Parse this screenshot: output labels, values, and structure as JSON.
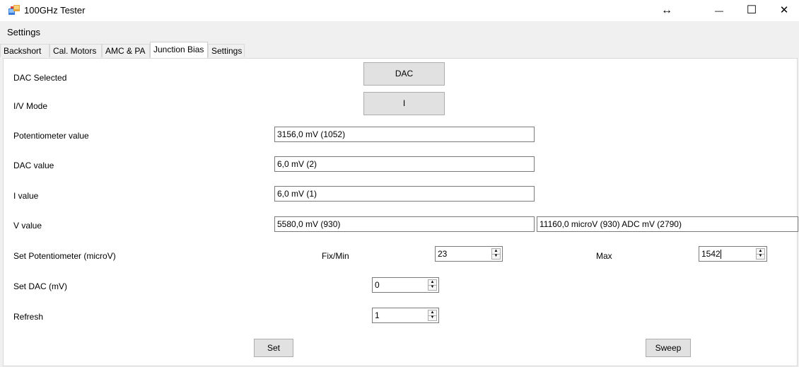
{
  "window": {
    "title": "100GHz Tester",
    "resize_indicator": "↔",
    "minimize": "—",
    "maximize": "☐",
    "close": "✕"
  },
  "menu": {
    "settings": "Settings"
  },
  "tabs": [
    {
      "label": "Backshort",
      "active": false
    },
    {
      "label": "Cal. Motors",
      "active": false
    },
    {
      "label": "AMC & PA",
      "active": false
    },
    {
      "label": "Junction Bias",
      "active": true
    },
    {
      "label": "Settings",
      "active": false
    }
  ],
  "junction_bias": {
    "dac_selected_label": "DAC Selected",
    "dac_button": "DAC",
    "iv_mode_label": "I/V Mode",
    "iv_button": "I",
    "potentiometer_label": "Potentiometer value",
    "potentiometer_value": "3156,0 mV (1052)",
    "dac_value_label": "DAC value",
    "dac_value": "6,0 mV (2)",
    "i_value_label": "I value",
    "i_value": "6,0 mV (1)",
    "v_value_label": "V value",
    "v_value": "5580,0 mV (930)",
    "v_value_adc": "11160,0 microV (930) ADC mV (2790)",
    "set_pot_label": "Set Potentiometer (microV)",
    "fix_min_label": "Fix/Min",
    "fix_min_value": "23",
    "max_label": "Max",
    "max_value": "1542",
    "set_dac_label": "Set DAC (mV)",
    "set_dac_value": "0",
    "refresh_label": "Refresh",
    "refresh_value": "1",
    "set_button": "Set",
    "sweep_button": "Sweep"
  },
  "colors": {
    "window_bg": "#f0f0f0",
    "panel_bg": "#ffffff",
    "button_bg": "#e1e1e1",
    "button_border": "#adadad"
  }
}
